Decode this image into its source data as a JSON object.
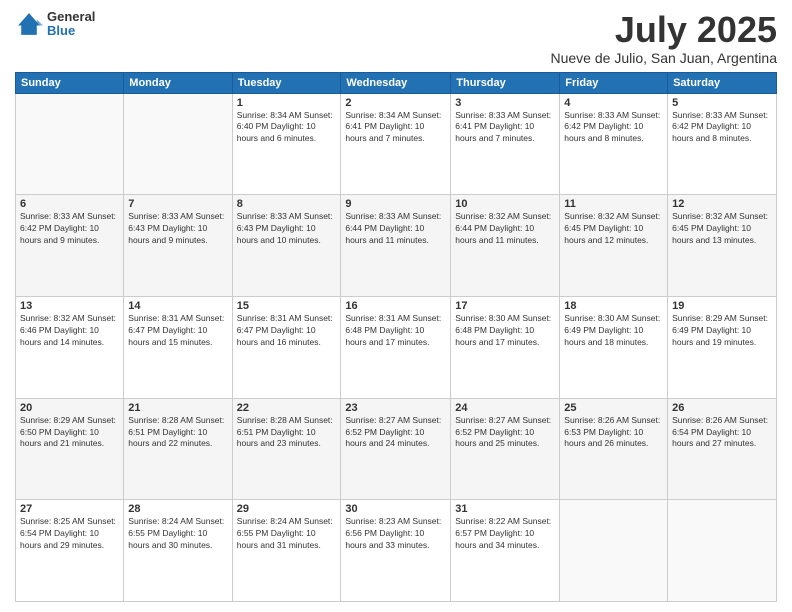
{
  "header": {
    "logo": {
      "general": "General",
      "blue": "Blue"
    },
    "title": "July 2025",
    "location": "Nueve de Julio, San Juan, Argentina"
  },
  "weekdays": [
    "Sunday",
    "Monday",
    "Tuesday",
    "Wednesday",
    "Thursday",
    "Friday",
    "Saturday"
  ],
  "weeks": [
    [
      {
        "day": "",
        "info": ""
      },
      {
        "day": "",
        "info": ""
      },
      {
        "day": "1",
        "info": "Sunrise: 8:34 AM\nSunset: 6:40 PM\nDaylight: 10 hours and 6 minutes."
      },
      {
        "day": "2",
        "info": "Sunrise: 8:34 AM\nSunset: 6:41 PM\nDaylight: 10 hours and 7 minutes."
      },
      {
        "day": "3",
        "info": "Sunrise: 8:33 AM\nSunset: 6:41 PM\nDaylight: 10 hours and 7 minutes."
      },
      {
        "day": "4",
        "info": "Sunrise: 8:33 AM\nSunset: 6:42 PM\nDaylight: 10 hours and 8 minutes."
      },
      {
        "day": "5",
        "info": "Sunrise: 8:33 AM\nSunset: 6:42 PM\nDaylight: 10 hours and 8 minutes."
      }
    ],
    [
      {
        "day": "6",
        "info": "Sunrise: 8:33 AM\nSunset: 6:42 PM\nDaylight: 10 hours and 9 minutes."
      },
      {
        "day": "7",
        "info": "Sunrise: 8:33 AM\nSunset: 6:43 PM\nDaylight: 10 hours and 9 minutes."
      },
      {
        "day": "8",
        "info": "Sunrise: 8:33 AM\nSunset: 6:43 PM\nDaylight: 10 hours and 10 minutes."
      },
      {
        "day": "9",
        "info": "Sunrise: 8:33 AM\nSunset: 6:44 PM\nDaylight: 10 hours and 11 minutes."
      },
      {
        "day": "10",
        "info": "Sunrise: 8:32 AM\nSunset: 6:44 PM\nDaylight: 10 hours and 11 minutes."
      },
      {
        "day": "11",
        "info": "Sunrise: 8:32 AM\nSunset: 6:45 PM\nDaylight: 10 hours and 12 minutes."
      },
      {
        "day": "12",
        "info": "Sunrise: 8:32 AM\nSunset: 6:45 PM\nDaylight: 10 hours and 13 minutes."
      }
    ],
    [
      {
        "day": "13",
        "info": "Sunrise: 8:32 AM\nSunset: 6:46 PM\nDaylight: 10 hours and 14 minutes."
      },
      {
        "day": "14",
        "info": "Sunrise: 8:31 AM\nSunset: 6:47 PM\nDaylight: 10 hours and 15 minutes."
      },
      {
        "day": "15",
        "info": "Sunrise: 8:31 AM\nSunset: 6:47 PM\nDaylight: 10 hours and 16 minutes."
      },
      {
        "day": "16",
        "info": "Sunrise: 8:31 AM\nSunset: 6:48 PM\nDaylight: 10 hours and 17 minutes."
      },
      {
        "day": "17",
        "info": "Sunrise: 8:30 AM\nSunset: 6:48 PM\nDaylight: 10 hours and 17 minutes."
      },
      {
        "day": "18",
        "info": "Sunrise: 8:30 AM\nSunset: 6:49 PM\nDaylight: 10 hours and 18 minutes."
      },
      {
        "day": "19",
        "info": "Sunrise: 8:29 AM\nSunset: 6:49 PM\nDaylight: 10 hours and 19 minutes."
      }
    ],
    [
      {
        "day": "20",
        "info": "Sunrise: 8:29 AM\nSunset: 6:50 PM\nDaylight: 10 hours and 21 minutes."
      },
      {
        "day": "21",
        "info": "Sunrise: 8:28 AM\nSunset: 6:51 PM\nDaylight: 10 hours and 22 minutes."
      },
      {
        "day": "22",
        "info": "Sunrise: 8:28 AM\nSunset: 6:51 PM\nDaylight: 10 hours and 23 minutes."
      },
      {
        "day": "23",
        "info": "Sunrise: 8:27 AM\nSunset: 6:52 PM\nDaylight: 10 hours and 24 minutes."
      },
      {
        "day": "24",
        "info": "Sunrise: 8:27 AM\nSunset: 6:52 PM\nDaylight: 10 hours and 25 minutes."
      },
      {
        "day": "25",
        "info": "Sunrise: 8:26 AM\nSunset: 6:53 PM\nDaylight: 10 hours and 26 minutes."
      },
      {
        "day": "26",
        "info": "Sunrise: 8:26 AM\nSunset: 6:54 PM\nDaylight: 10 hours and 27 minutes."
      }
    ],
    [
      {
        "day": "27",
        "info": "Sunrise: 8:25 AM\nSunset: 6:54 PM\nDaylight: 10 hours and 29 minutes."
      },
      {
        "day": "28",
        "info": "Sunrise: 8:24 AM\nSunset: 6:55 PM\nDaylight: 10 hours and 30 minutes."
      },
      {
        "day": "29",
        "info": "Sunrise: 8:24 AM\nSunset: 6:55 PM\nDaylight: 10 hours and 31 minutes."
      },
      {
        "day": "30",
        "info": "Sunrise: 8:23 AM\nSunset: 6:56 PM\nDaylight: 10 hours and 33 minutes."
      },
      {
        "day": "31",
        "info": "Sunrise: 8:22 AM\nSunset: 6:57 PM\nDaylight: 10 hours and 34 minutes."
      },
      {
        "day": "",
        "info": ""
      },
      {
        "day": "",
        "info": ""
      }
    ]
  ]
}
